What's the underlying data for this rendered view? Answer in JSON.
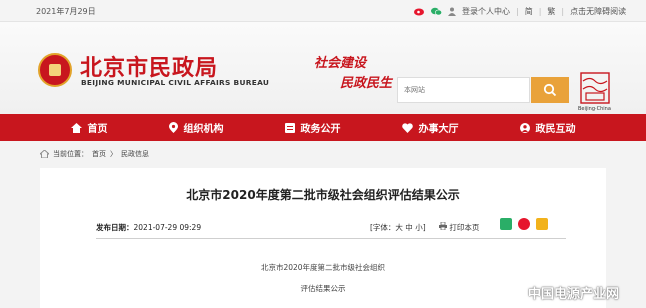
{
  "topbar": {
    "date": "2021年7月29日",
    "login": "登录个人中心",
    "simplified": "简",
    "traditional": "繁",
    "accessibility": "点击无障碍阅读"
  },
  "header": {
    "title": "北京市民政局",
    "subtitle": "BEIJING MUNICIPAL CIVIL AFFAIRS BUREAU",
    "slogan_line1": "社会建设",
    "slogan_line2": "民政民生",
    "search_placeholder": "本网站",
    "capital_caption": "Beijing·China"
  },
  "nav": [
    {
      "label": "首页",
      "icon": "home-icon"
    },
    {
      "label": "组织机构",
      "icon": "location-icon"
    },
    {
      "label": "政务公开",
      "icon": "document-icon"
    },
    {
      "label": "办事大厅",
      "icon": "heart-icon"
    },
    {
      "label": "政民互动",
      "icon": "person-icon"
    }
  ],
  "breadcrumb": {
    "prefix": "当前位置：",
    "home": "首页",
    "sep": "〉",
    "section": "民政信息"
  },
  "article": {
    "title": "北京市2020年度第二批市级社会组织评估结果公示",
    "date_label": "发布日期：",
    "date": "2021-07-29 09:29",
    "font_size": "[字体：大 中 小]",
    "print": "打印本页",
    "line1": "北京市2020年度第二批市级社会组织",
    "line2": "评估结果公示"
  },
  "watermark": "中国电源产业网",
  "colors": {
    "brand_red": "#c8161e",
    "search_orange": "#e9a23a"
  }
}
